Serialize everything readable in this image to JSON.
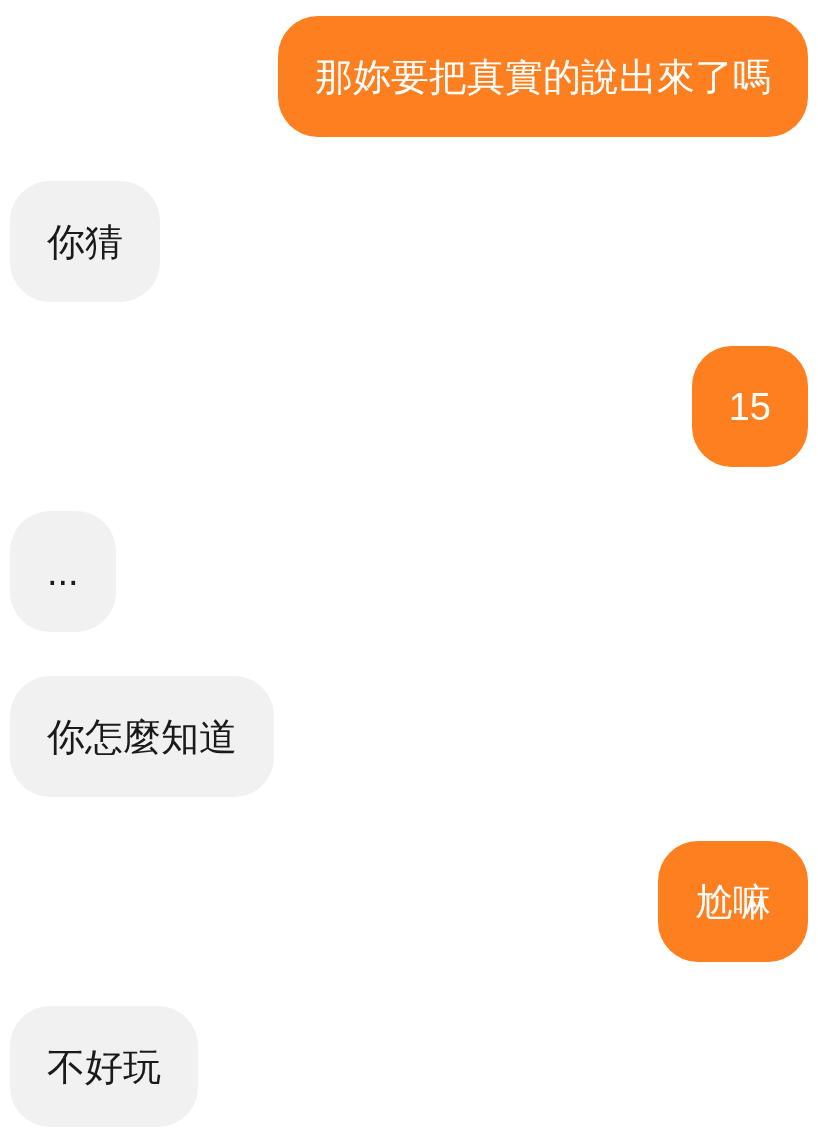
{
  "messages": [
    {
      "kind": "sent",
      "text": "那妳要把真實的說出來了嗎"
    },
    {
      "kind": "received",
      "text": "你猜"
    },
    {
      "kind": "sent",
      "text": "15"
    },
    {
      "kind": "received",
      "text": "..."
    },
    {
      "kind": "received",
      "text": "你怎麼知道"
    },
    {
      "kind": "sent",
      "text": "尬嘛"
    },
    {
      "kind": "received",
      "text": "不好玩"
    }
  ]
}
